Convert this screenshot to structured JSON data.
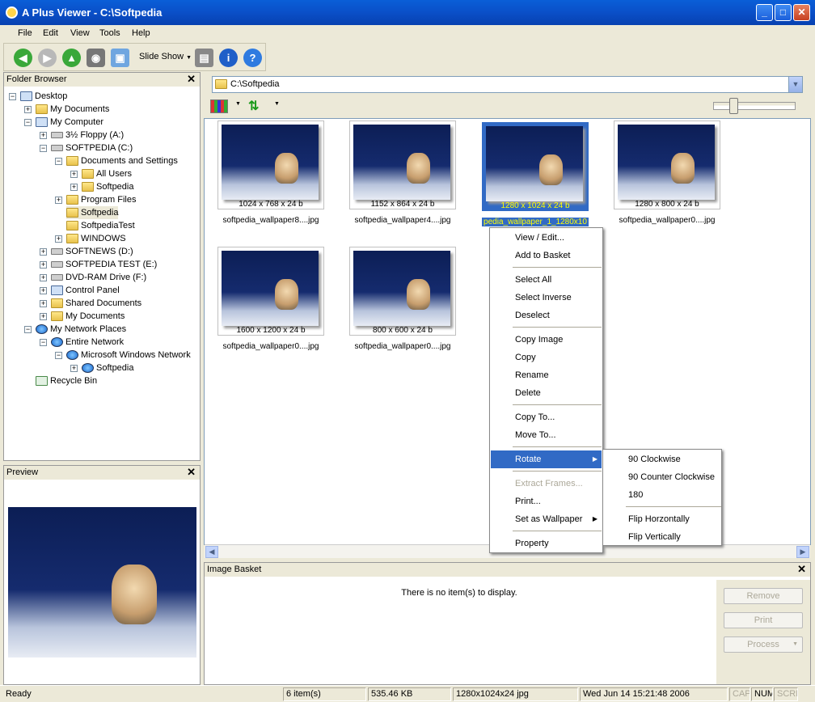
{
  "window": {
    "title": "A Plus Viewer - C:\\Softpedia",
    "min": "_",
    "max": "□",
    "close": "✕"
  },
  "menu": [
    "File",
    "Edit",
    "View",
    "Tools",
    "Help"
  ],
  "toolbar": {
    "slideshow_label": "Slide Show",
    "icons": [
      "back-icon",
      "forward-icon",
      "up-icon",
      "camera-icon",
      "wallpaper-icon",
      "printer-icon",
      "info-icon",
      "help-icon"
    ]
  },
  "folder_browser": {
    "title": "Folder Browser",
    "close": "✕",
    "items": [
      {
        "label": "Desktop"
      },
      {
        "label": "My Documents"
      },
      {
        "label": "My Computer"
      },
      {
        "label": "3½ Floppy (A:)"
      },
      {
        "label": "SOFTPEDIA (C:)"
      },
      {
        "label": "Documents and Settings"
      },
      {
        "label": "All Users"
      },
      {
        "label": "Softpedia"
      },
      {
        "label": "Program Files"
      },
      {
        "label": "Softpedia"
      },
      {
        "label": "SoftpediaTest"
      },
      {
        "label": "WINDOWS"
      },
      {
        "label": "SOFTNEWS (D:)"
      },
      {
        "label": "SOFTPEDIA TEST (E:)"
      },
      {
        "label": "DVD-RAM Drive (F:)"
      },
      {
        "label": "Control Panel"
      },
      {
        "label": "Shared Documents"
      },
      {
        "label": "My Documents"
      },
      {
        "label": "My Network Places"
      },
      {
        "label": "Entire Network"
      },
      {
        "label": "Microsoft Windows Network"
      },
      {
        "label": "Softpedia"
      },
      {
        "label": "Recycle Bin"
      }
    ]
  },
  "preview": {
    "title": "Preview",
    "close": "✕"
  },
  "address": {
    "path": "C:\\Softpedia",
    "dropdown": "▼"
  },
  "thumbnails": [
    {
      "dim": "1024 x 768 x 24 b",
      "name": "softpedia_wallpaper8....jpg"
    },
    {
      "dim": "1152 x 864 x 24 b",
      "name": "softpedia_wallpaper4....jpg"
    },
    {
      "dim": "1280 x 1024 x 24 b",
      "name": "pedia_wallpaper_1_1280x10"
    },
    {
      "dim": "1280 x 800 x 24 b",
      "name": "softpedia_wallpaper0....jpg"
    },
    {
      "dim": "1600 x 1200 x 24 b",
      "name": "softpedia_wallpaper0....jpg"
    },
    {
      "dim": "800 x 600 x 24 b",
      "name": "softpedia_wallpaper0....jpg"
    }
  ],
  "context_menu": {
    "items": [
      "View / Edit...",
      "Add to Basket",
      "Select All",
      "Select Inverse",
      "Deselect",
      "Copy Image",
      "Copy",
      "Rename",
      "Delete",
      "Copy To...",
      "Move To...",
      "Rotate",
      "Extract Frames...",
      "Print...",
      "Set as Wallpaper",
      "Property"
    ],
    "submenu_arrow": "▶"
  },
  "rotate_submenu": [
    "90 Clockwise",
    "90 Counter Clockwise",
    "180",
    "Flip Horzontally",
    "Flip Vertically"
  ],
  "basket": {
    "title": "Image Basket",
    "close": "✕",
    "empty_text": "There is no item(s) to display.",
    "remove": "Remove",
    "print": "Print",
    "process": "Process",
    "process_arrow": "▼"
  },
  "status": {
    "ready": "Ready",
    "count": "6 item(s)",
    "size": "535.46 KB",
    "format": "1280x1024x24 jpg",
    "datetime": "Wed Jun 14 15:21:48 2006",
    "cap": "CAP",
    "num": "NUM",
    "scrl": "SCRL"
  },
  "colors": {
    "selection": "#316ac5",
    "title_bar": "#0a4fc8",
    "selected_text": "#ffff00"
  }
}
